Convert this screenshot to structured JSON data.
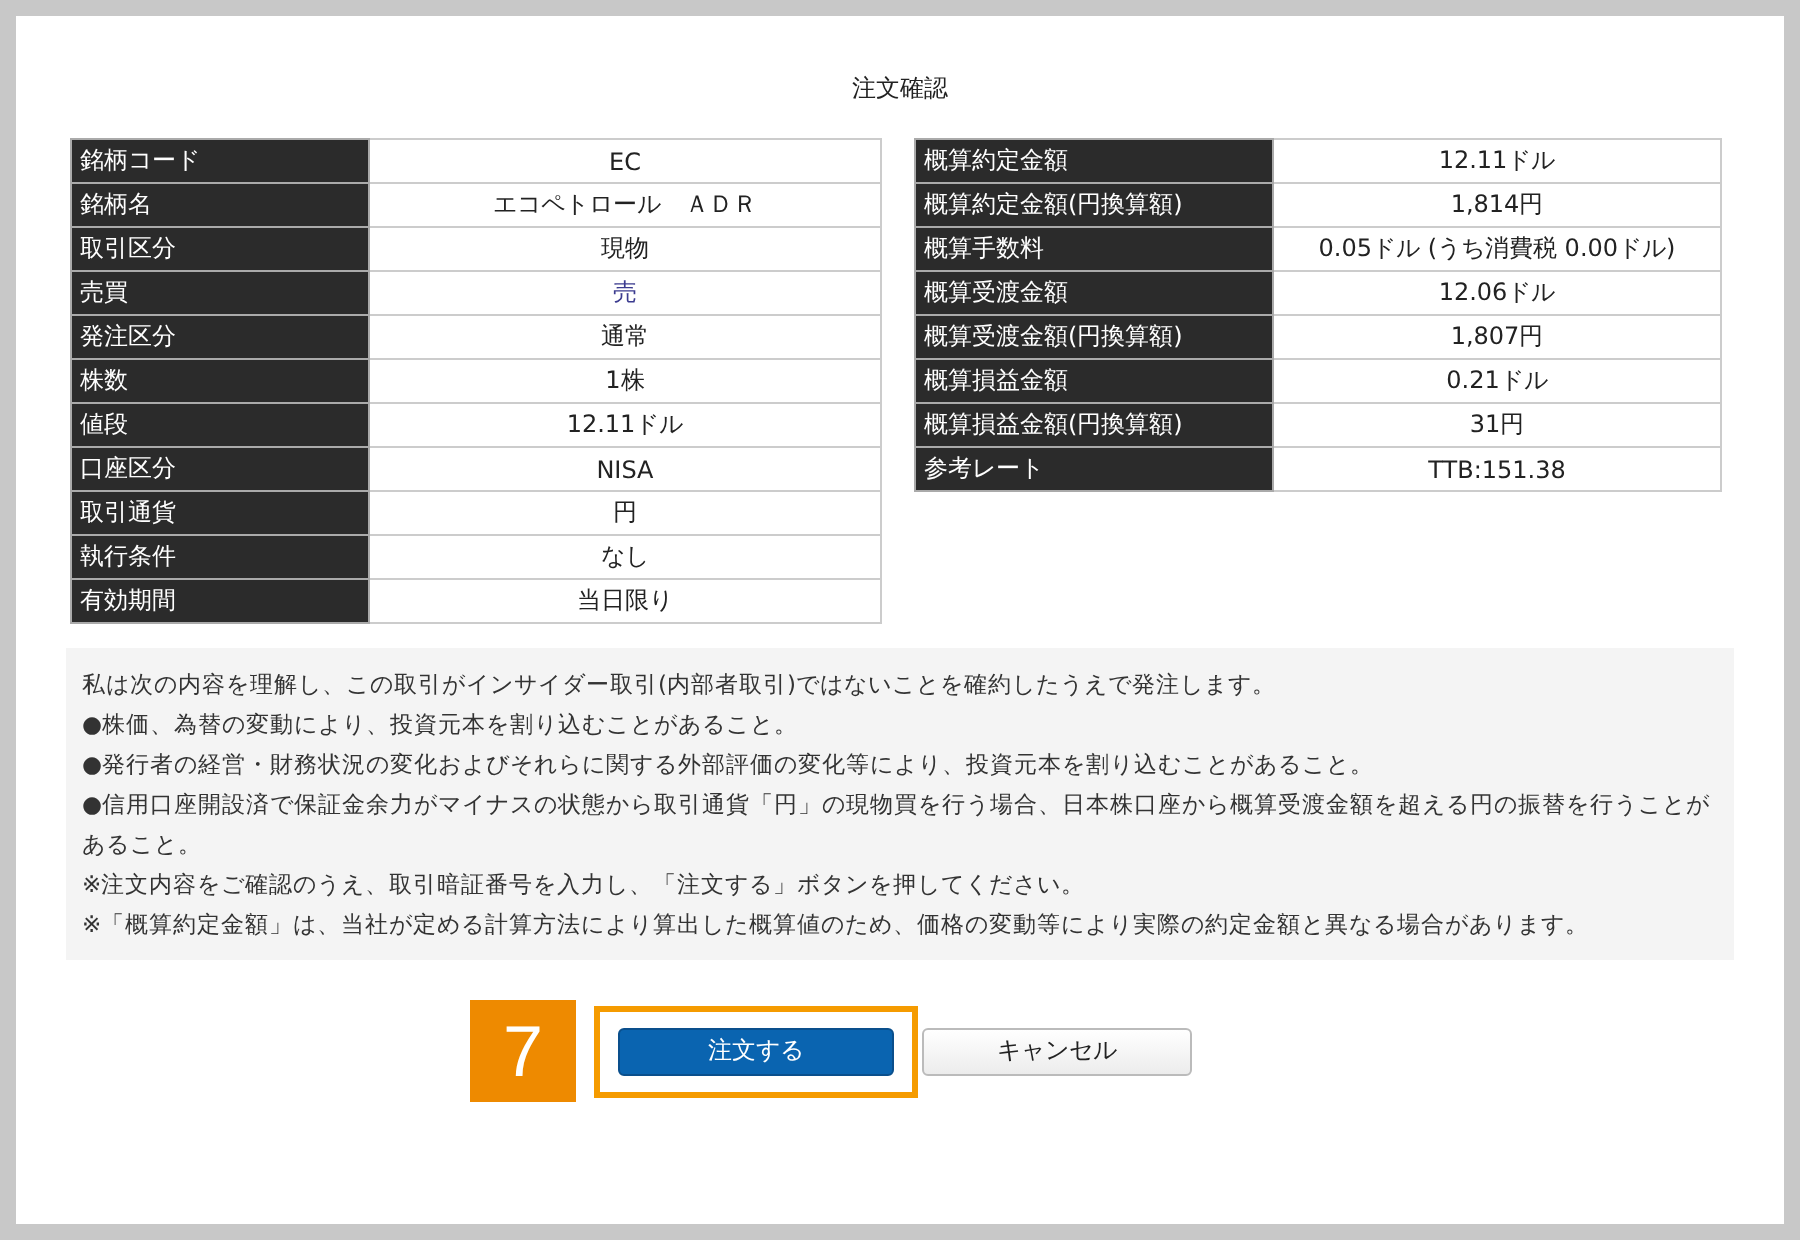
{
  "title": "注文確認",
  "order_table": [
    {
      "label": "銘柄コード",
      "value": "EC"
    },
    {
      "label": "銘柄名",
      "value": "エコペトロール　ＡＤＲ"
    },
    {
      "label": "取引区分",
      "value": "現物"
    },
    {
      "label": "売買",
      "value": "売",
      "color": "#3b3b8f"
    },
    {
      "label": "発注区分",
      "value": "通常"
    },
    {
      "label": "株数",
      "value": "1株"
    },
    {
      "label": "値段",
      "value": "12.11ドル"
    },
    {
      "label": "口座区分",
      "value": "NISA"
    },
    {
      "label": "取引通貨",
      "value": "円"
    },
    {
      "label": "執行条件",
      "value": "なし"
    },
    {
      "label": "有効期間",
      "value": "当日限り"
    }
  ],
  "estimate_table": [
    {
      "label": "概算約定金額",
      "value": "12.11ドル"
    },
    {
      "label": "概算約定金額(円換算額)",
      "value": "1,814円"
    },
    {
      "label": "概算手数料",
      "value": "0.05ドル (うち消費税 0.00ドル)"
    },
    {
      "label": "概算受渡金額",
      "value": "12.06ドル"
    },
    {
      "label": "概算受渡金額(円換算額)",
      "value": "1,807円"
    },
    {
      "label": "概算損益金額",
      "value": "0.21ドル"
    },
    {
      "label": "概算損益金額(円換算額)",
      "value": "31円"
    },
    {
      "label": "参考レート",
      "value": "TTB:151.38"
    }
  ],
  "notice": [
    "私は次の内容を理解し、この取引がインサイダー取引(内部者取引)ではないことを確約したうえで発注します。",
    "●株価、為替の変動により、投資元本を割り込むことがあること。",
    "●発行者の経営・財務状況の変化およびそれらに関する外部評価の変化等により、投資元本を割り込むことがあること。",
    "●信用口座開設済で保証金余力がマイナスの状態から取引通貨「円」の現物買を行う場合、日本株口座から概算受渡金額を超える円の振替を行うことがあること。",
    "※注文内容をご確認のうえ、取引暗証番号を入力し、「注文する」ボタンを押してください。",
    "※「概算約定金額」は、当社が定める計算方法により算出した概算値のため、価格の変動等により実際の約定金額と異なる場合があります。"
  ],
  "step_badge": "7",
  "buttons": [
    {
      "kind": "primary",
      "label": "注文する",
      "highlighted": true
    },
    {
      "kind": "secondary",
      "label": "キャンセル",
      "highlighted": false
    }
  ]
}
